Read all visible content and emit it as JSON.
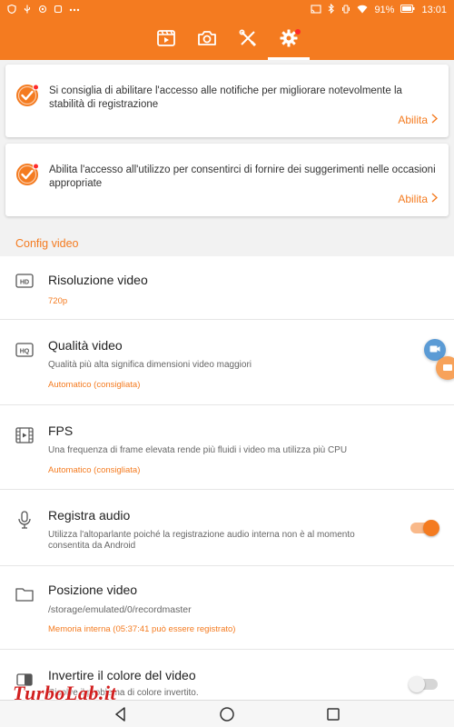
{
  "status_bar": {
    "battery": "91%",
    "time": "13:01"
  },
  "tabs": [
    {
      "name": "video-list-icon",
      "active": false
    },
    {
      "name": "camera-icon",
      "active": false
    },
    {
      "name": "tools-icon",
      "active": false
    },
    {
      "name": "settings-gear-icon",
      "active": true,
      "notification_dot": true
    }
  ],
  "cards": [
    {
      "message": "Si consiglia di abilitare l'accesso alle notifiche per migliorare notevolmente la stabilità di registrazione",
      "action": "Abilita"
    },
    {
      "message": "Abilita l'accesso all'utilizzo per consentirci di fornire dei suggerimenti nelle occasioni appropriate",
      "action": "Abilita"
    }
  ],
  "section_title": "Config video",
  "settings": [
    {
      "icon": "hd-icon",
      "title": "Risoluzione video",
      "description": "",
      "value": "720p"
    },
    {
      "icon": "hq-icon",
      "title": "Qualità video",
      "description": "Qualità più alta significa dimensioni video maggiori",
      "value": "Automatico (consigliata)"
    },
    {
      "icon": "film-icon",
      "title": "FPS",
      "description": "Una frequenza di frame elevata rende più fluidi i video ma utilizza più CPU",
      "value": "Automatico (consigliata)"
    },
    {
      "icon": "microphone-icon",
      "title": "Registra audio",
      "description": "Utilizza l'altoparlante poiché la registrazione audio interna non è al momento consentita da Android",
      "toggle": true
    },
    {
      "icon": "folder-icon",
      "title": "Posizione video",
      "description": "/storage/emulated/0/recordmaster",
      "value": "Memoria interna (05:37:41 può essere registrato)"
    },
    {
      "icon": "invert-color-icon",
      "title": "Invertire il colore del video",
      "description": "Risolve il problema di colore invertito.",
      "toggle": false
    }
  ],
  "watermark": "TurboLab.it",
  "colors": {
    "accent": "#f47b20",
    "toggle_off": "#c8c8c8",
    "notification_dot": "#ff2a2a"
  }
}
